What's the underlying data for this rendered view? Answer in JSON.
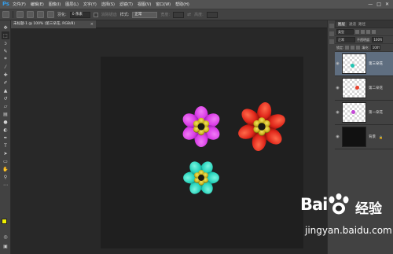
{
  "app": {
    "logo": "Ps"
  },
  "menu": [
    "文件(F)",
    "编辑(E)",
    "图像(I)",
    "图层(L)",
    "文字(Y)",
    "选择(S)",
    "滤镜(T)",
    "视图(V)",
    "窗口(W)",
    "帮助(H)"
  ],
  "window_controls": [
    "—",
    "□",
    "✕"
  ],
  "options_bar": {
    "feather_label": "羽化:",
    "feather_value": "0 像素",
    "antialias_label": "消除锯齿",
    "style_label": "样式:",
    "style_value": "正常",
    "width_label": "宽度:",
    "height_label": "高度:"
  },
  "document_tab": {
    "title": "未标题-1 @ 100% (第三朵花, RGB/8)",
    "close": "×"
  },
  "panels": {
    "tabs": [
      "图层",
      "通道",
      "路径"
    ],
    "filter_label": "类型",
    "blend_mode": "正常",
    "opacity_label": "不透明度:",
    "opacity_value": "100%",
    "lock_label": "锁定:",
    "fill_label": "填充:",
    "fill_value": "100%"
  },
  "layers": [
    {
      "name": "第三朵花",
      "selected": true,
      "visible": true,
      "thumb_color": "#21c6b3"
    },
    {
      "name": "第二朵花",
      "selected": false,
      "visible": true,
      "thumb_color": "#e8402c"
    },
    {
      "name": "第一朵花",
      "selected": false,
      "visible": true,
      "thumb_color": "#c447d6"
    },
    {
      "name": "背景",
      "selected": false,
      "visible": true,
      "thumb_color": "#111111"
    }
  ],
  "colors": {
    "foreground": "#f0f000",
    "background": "#ffffff",
    "canvas": "#1f1f1f"
  },
  "flowers": [
    {
      "name": "purple-flower",
      "petal": "#d93ce6",
      "petal_dark": "#8a1aa0",
      "center": "#c9b21c"
    },
    {
      "name": "red-flower",
      "petal": "#e0271b",
      "petal_dark": "#8a0d08",
      "center": "#c9b21c"
    },
    {
      "name": "teal-flower",
      "petal": "#27d3bb",
      "petal_dark": "#0f7a70",
      "center": "#c9b21c"
    }
  ],
  "watermark": {
    "brand": "Bai",
    "brand_cn": "经验",
    "url": "jingyan.baidu.com"
  }
}
